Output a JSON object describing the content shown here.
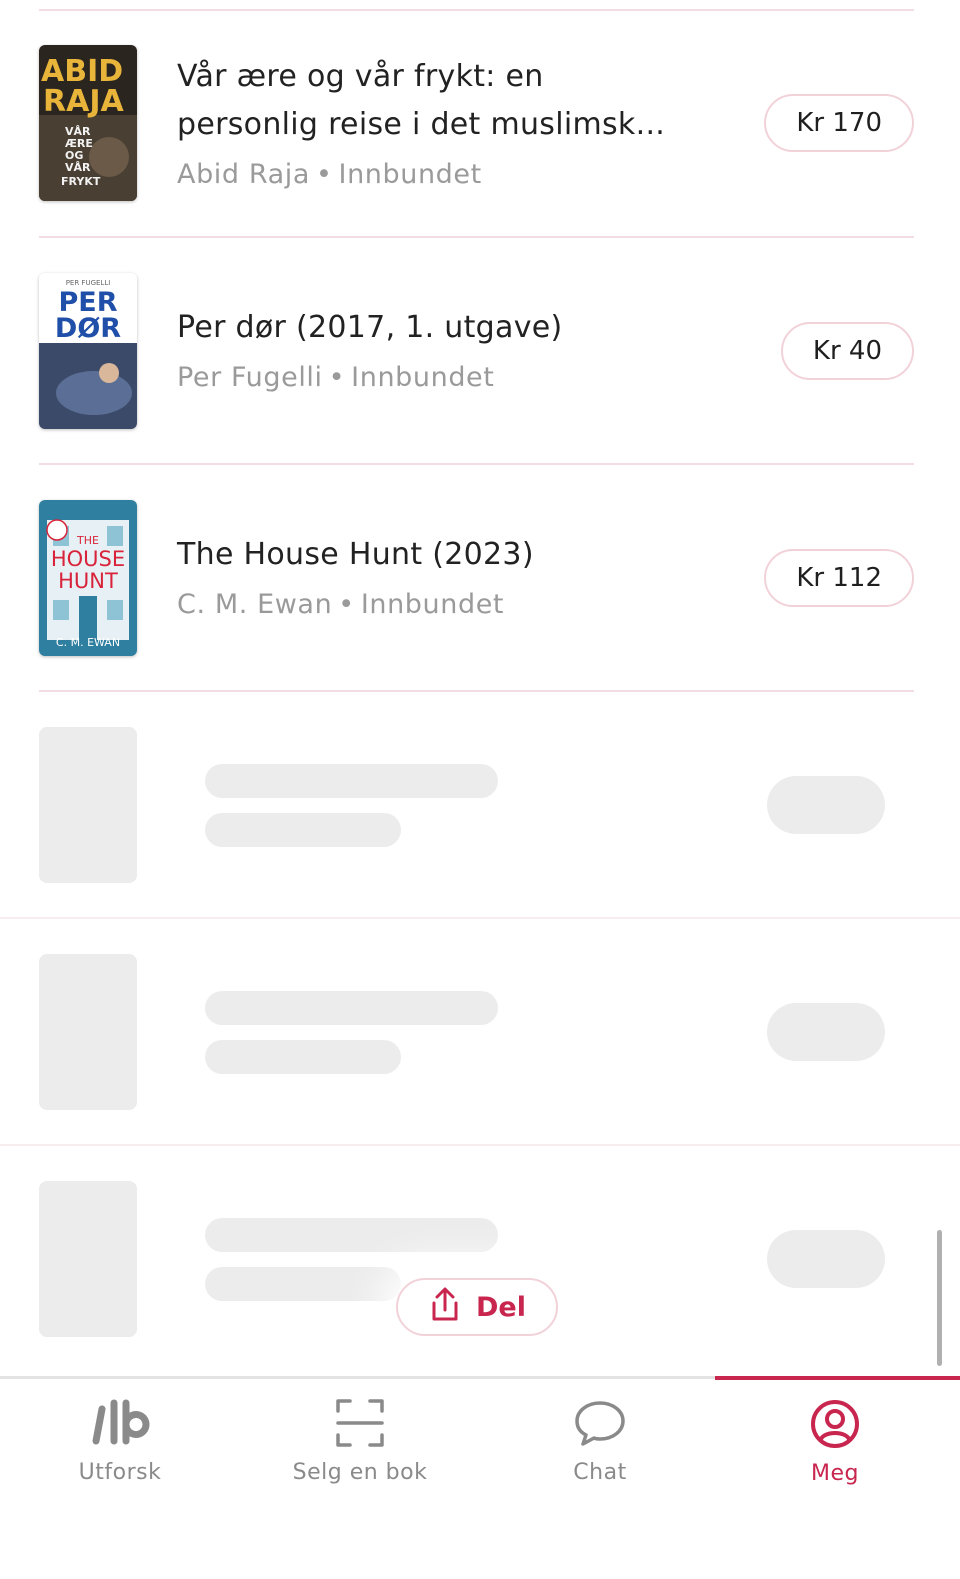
{
  "books": [
    {
      "title_line1": "Vår ære og vår frykt: en",
      "title_line2": "personlig reise i det muslimsk...",
      "author": "Abid Raja",
      "separator": "•",
      "format": "Innbundet",
      "price": "Kr 170",
      "cover": {
        "line1": "ABID",
        "line2": "RAJA",
        "sub1": "VÅR",
        "sub2": "ÆRE",
        "sub3": "OG",
        "sub4": "VÅR",
        "sub5": "FRYKT",
        "accent": "#e8b43a",
        "bg": "#2b2520"
      }
    },
    {
      "title_line1": "Per dør (2017, 1. utgave)",
      "author": "Per Fugelli",
      "separator": "•",
      "format": "Innbundet",
      "price": "Kr 40",
      "cover": {
        "top": "PER FUGELLI",
        "line1": "PER",
        "line2": "DØR",
        "accent": "#1f4fa8"
      }
    },
    {
      "title_line1": "The House Hunt (2023)",
      "author": "C. M. Ewan",
      "separator": "•",
      "format": "Innbundet",
      "price": "Kr 112",
      "cover": {
        "line0": "THE",
        "line1": "HOUSE",
        "line2": "HUNT",
        "author": "C. M. EWAN",
        "accent": "#d8233a",
        "bg": "#2f7fa0"
      }
    }
  ],
  "share": {
    "label": "Del",
    "icon": "share-icon"
  },
  "nav": [
    {
      "label": "Utforsk",
      "icon": "brand-logo-icon",
      "active": false
    },
    {
      "label": "Selg en bok",
      "icon": "scan-icon",
      "active": false
    },
    {
      "label": "Chat",
      "icon": "chat-bubble-icon",
      "active": false
    },
    {
      "label": "Meg",
      "icon": "user-profile-icon",
      "active": true
    }
  ],
  "colors": {
    "accent": "#c8264e",
    "muted": "#9a9a9a",
    "skeleton": "#ececec",
    "divider": "#f3dde2"
  }
}
